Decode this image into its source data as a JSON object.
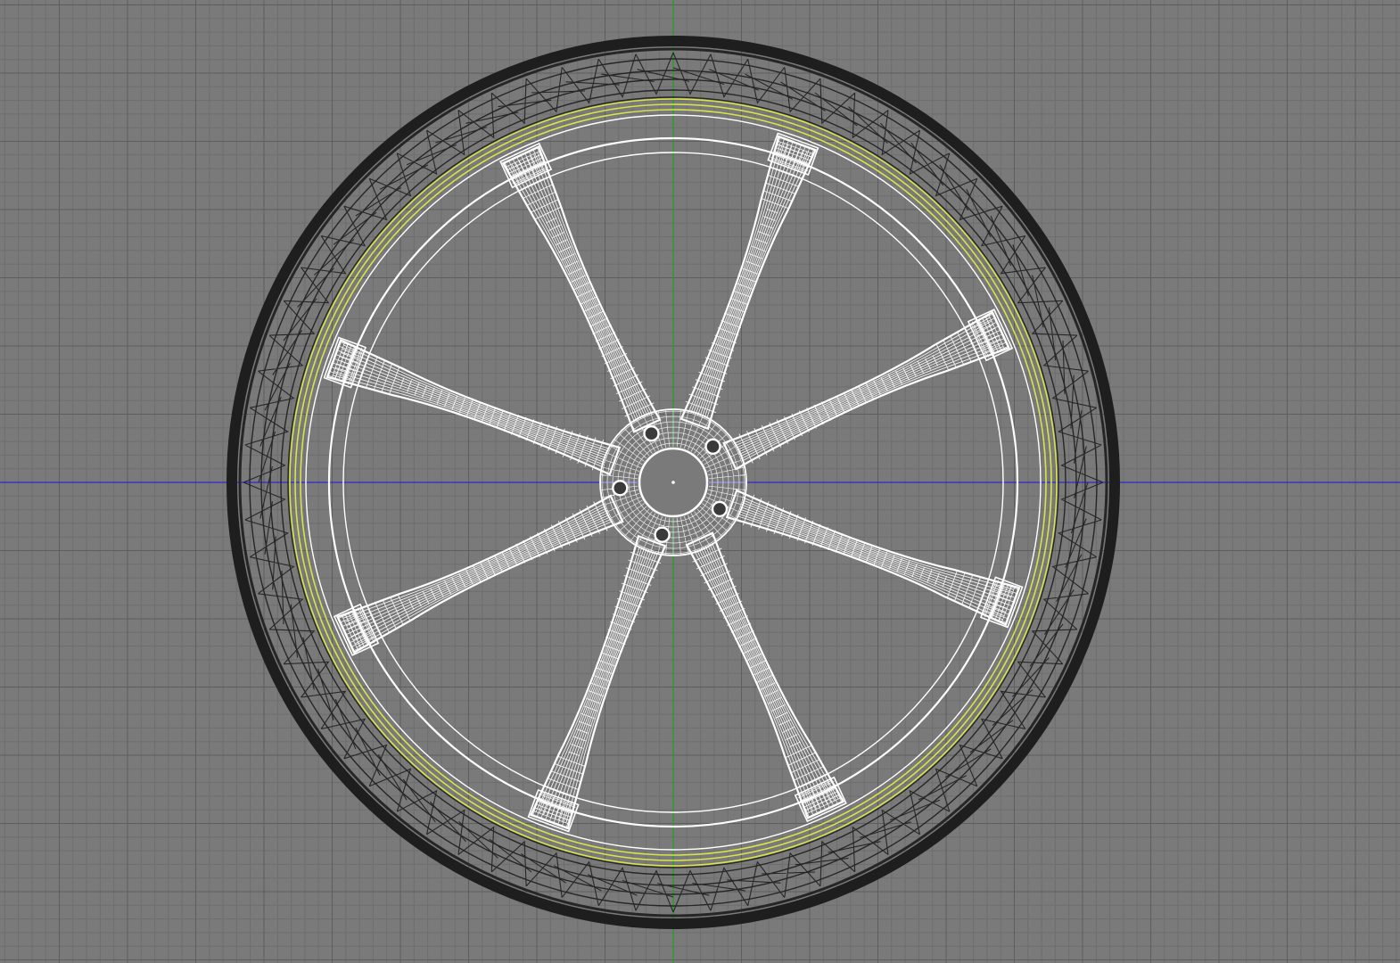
{
  "viewport": {
    "background": "#7a7a7a",
    "grid_minor_color": "#6e6e6e",
    "grid_major_color": "#5e5e5e",
    "x_axis_color": "#2a2ad0",
    "y_axis_color": "#1fa01f"
  },
  "wheel": {
    "tire_color": "#1e1e1e",
    "tire_structure_color": "#262626",
    "rim_edge_color": "#d8e24a",
    "rim_color": "#ffffff",
    "spoke_color": "#ffffff",
    "spoke_count": 8,
    "lug_nut_count": 5
  }
}
